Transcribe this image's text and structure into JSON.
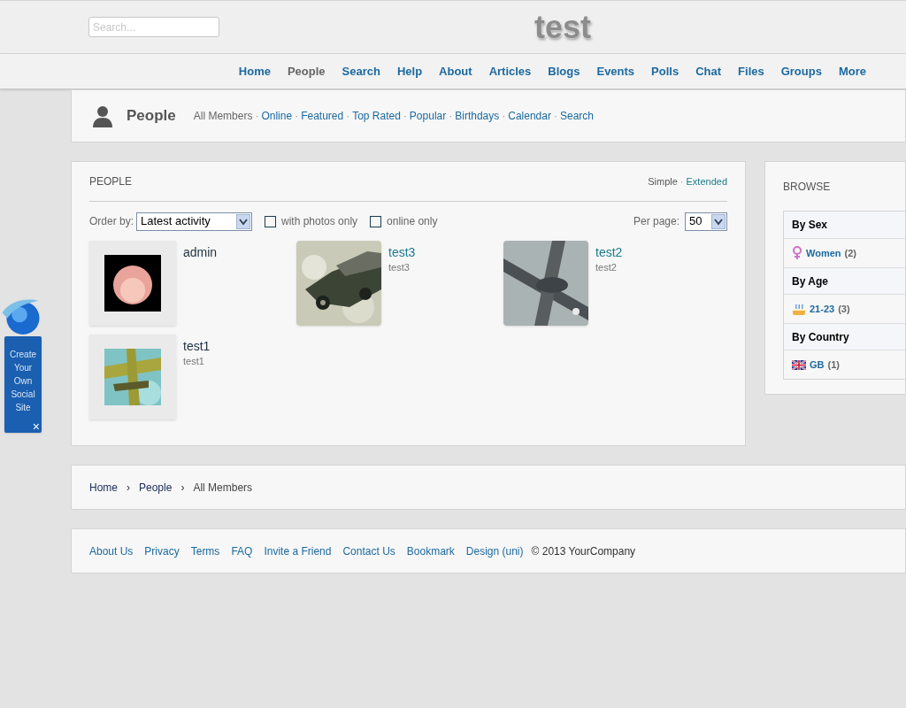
{
  "header": {
    "search": {
      "placeholder": "Search..."
    },
    "site_title": "test"
  },
  "nav": [
    {
      "label": "Home",
      "selected": false
    },
    {
      "label": "People",
      "selected": true
    },
    {
      "label": "Search",
      "selected": false
    },
    {
      "label": "Help",
      "selected": false
    },
    {
      "label": "About",
      "selected": false
    },
    {
      "label": "Articles",
      "selected": false
    },
    {
      "label": "Blogs",
      "selected": false
    },
    {
      "label": "Events",
      "selected": false
    },
    {
      "label": "Polls",
      "selected": false
    },
    {
      "label": "Chat",
      "selected": false
    },
    {
      "label": "Files",
      "selected": false
    },
    {
      "label": "Groups",
      "selected": false
    },
    {
      "label": "More",
      "selected": false
    }
  ],
  "separator": "·",
  "section": {
    "title": "People",
    "tabs": [
      {
        "label": "All Members",
        "selected": true
      },
      {
        "label": "Online",
        "selected": false
      },
      {
        "label": "Featured",
        "selected": false
      },
      {
        "label": "Top Rated",
        "selected": false
      },
      {
        "label": "Popular",
        "selected": false
      },
      {
        "label": "Birthdays",
        "selected": false
      },
      {
        "label": "Calendar",
        "selected": false
      },
      {
        "label": "Search",
        "selected": false
      }
    ]
  },
  "people": {
    "title": "PEOPLE",
    "views": [
      {
        "label": "Simple",
        "selected": true
      },
      {
        "label": "Extended",
        "selected": false
      }
    ],
    "order_label": "Order by:",
    "order_value": "Latest activity",
    "filters": [
      {
        "label": "with photos only",
        "checked": false
      },
      {
        "label": "online only",
        "checked": false
      }
    ],
    "per_page_label": "Per page:",
    "per_page_value": "50",
    "members": [
      {
        "name": "admin",
        "kind": "avatar",
        "visited": true
      },
      {
        "name": "test3",
        "username": "test3",
        "visited": false
      },
      {
        "name": "test2",
        "username": "test2",
        "visited": false
      },
      {
        "name": "test1",
        "username": "test1",
        "kind": "framed-photo",
        "visited": true
      }
    ]
  },
  "browse": {
    "title": "BROWSE",
    "groups": [
      {
        "heading": "By Sex",
        "items": [
          {
            "kind": "female",
            "label": "Women",
            "count": "(2)"
          }
        ]
      },
      {
        "heading": "By Age",
        "items": [
          {
            "kind": "cake",
            "label": "21-23",
            "count": "(3)"
          }
        ]
      },
      {
        "heading": "By Country",
        "items": [
          {
            "kind": "flag",
            "label": "GB",
            "count": "(1)"
          }
        ]
      }
    ]
  },
  "breadcrumb": [
    {
      "label": "Home",
      "current": false
    },
    {
      "label": "People",
      "current": false
    },
    {
      "label": "All Members",
      "current": true
    }
  ],
  "breadcrumb_separator": "›",
  "footer": {
    "links": [
      "About Us",
      "Privacy",
      "Terms",
      "FAQ",
      "Invite a Friend",
      "Contact Us",
      "Bookmark",
      "Design (uni)"
    ],
    "copyright": "© 2013 YourCompany"
  },
  "promo": {
    "text": "Create Your Own Social Site",
    "close": "×"
  }
}
